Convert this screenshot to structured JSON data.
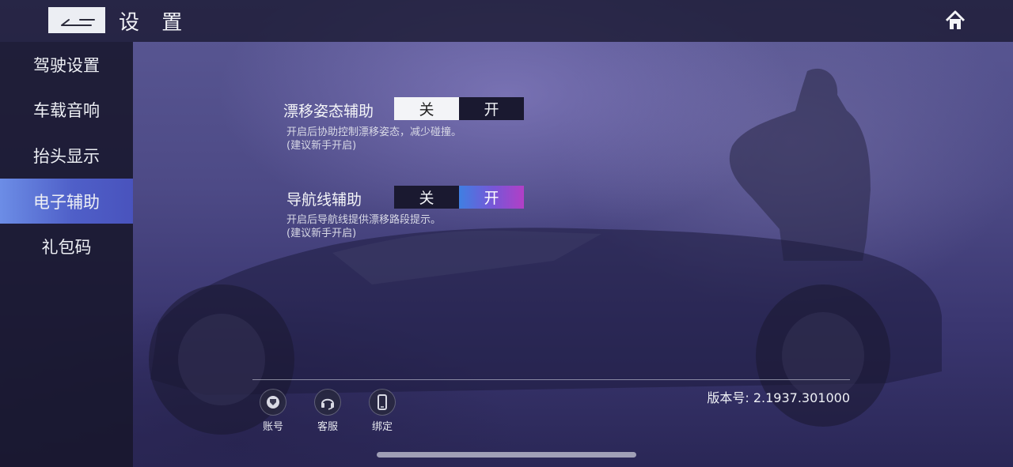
{
  "header": {
    "title": "设 置",
    "back_icon": "back-arrow-icon",
    "home_icon": "home-icon"
  },
  "sidebar": {
    "items": [
      {
        "label": "驾驶设置",
        "active": false
      },
      {
        "label": "车载音响",
        "active": false
      },
      {
        "label": "抬头显示",
        "active": false
      },
      {
        "label": "电子辅助",
        "active": true
      },
      {
        "label": "礼包码",
        "active": false
      }
    ]
  },
  "settings": [
    {
      "label": "漂移姿态辅助",
      "off_label": "关",
      "on_label": "开",
      "selected": "关",
      "desc_line1": "开启后协助控制漂移姿态，减少碰撞。",
      "desc_line2": "(建议新手开启)"
    },
    {
      "label": "导航线辅助",
      "off_label": "关",
      "on_label": "开",
      "selected": "开",
      "desc_line1": "开启后导航线提供漂移路段提示。",
      "desc_line2": "(建议新手开启)"
    }
  ],
  "footer": {
    "buttons": [
      {
        "label": "账号",
        "icon": "account-icon"
      },
      {
        "label": "客服",
        "icon": "headset-icon"
      },
      {
        "label": "绑定",
        "icon": "phone-icon"
      }
    ],
    "version_label": "版本号:",
    "version_value": "2.1937.301000"
  },
  "colors": {
    "active_nav": "#5a6fd6",
    "toggle_on_gradient_start": "#3f7fe2",
    "toggle_on_gradient_end": "#b23fc6",
    "toggle_off_selected": "#f3f4f7"
  }
}
